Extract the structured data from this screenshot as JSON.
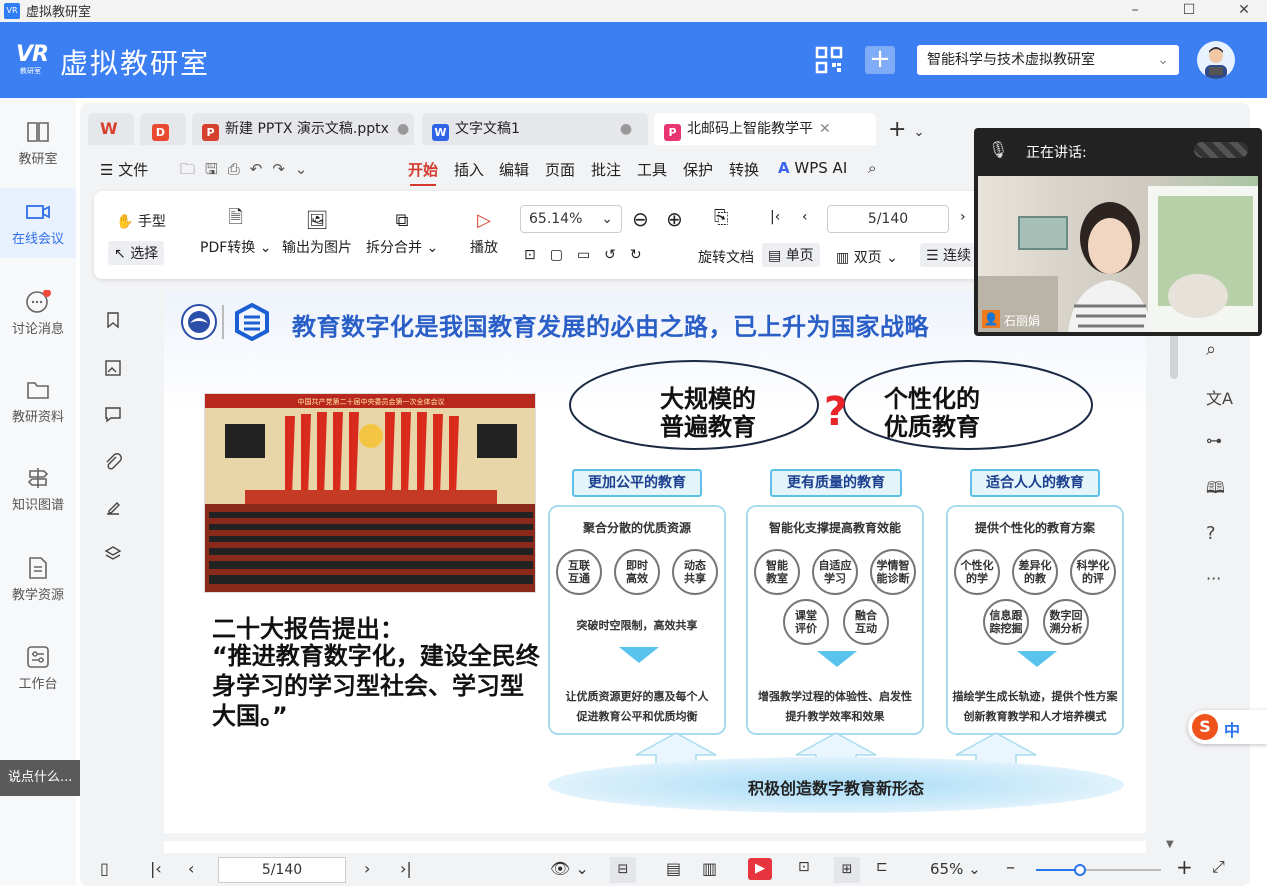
{
  "window": {
    "title": "虚拟教研室",
    "logo_text": "VR"
  },
  "header": {
    "brand_logo": "VR",
    "brand_logo_sub": "教研室",
    "brand_name": "虚拟教研室",
    "room_selector": "智能科学与技术虚拟教研室",
    "accent": "#3c7ff2"
  },
  "nav": {
    "items": [
      {
        "label": "教研室",
        "icon": "book-icon"
      },
      {
        "label": "在线会议",
        "icon": "video-camera-icon"
      },
      {
        "label": "讨论消息",
        "icon": "chat-bubble-icon"
      },
      {
        "label": "教研资料",
        "icon": "folder-icon"
      },
      {
        "label": "知识图谱",
        "icon": "signpost-icon"
      },
      {
        "label": "教学资源",
        "icon": "document-icon"
      },
      {
        "label": "工作台",
        "icon": "dashboard-icon"
      }
    ],
    "say_something": "说点什么..."
  },
  "wps": {
    "tabs": [
      {
        "label": "新建 PPTX 演示文稿.pptx",
        "icon": "P",
        "color": "#d6402f"
      },
      {
        "label": "文字文稿1",
        "icon": "W",
        "color": "#2f64e8"
      },
      {
        "label": "北邮码上智能教学平",
        "icon": "P",
        "color": "#e8346f"
      }
    ],
    "menus": [
      "文件",
      "开始",
      "插入",
      "编辑",
      "页面",
      "批注",
      "工具",
      "保护",
      "转换",
      "WPS AI"
    ],
    "toolbar": {
      "hand": "手型",
      "select": "选择",
      "pdf_convert": "PDF转换",
      "export_image": "输出为图片",
      "split_merge": "拆分合并",
      "play": "播放",
      "zoom": "65.14%",
      "rotate": "旋转文档",
      "single": "单页",
      "double": "双页",
      "continuous": "连续",
      "page": "5/140"
    },
    "bottom": {
      "page": "5/140",
      "zoom": "65%",
      "zoom_level": 0.35
    }
  },
  "slide": {
    "title": "教育数字化是我国教育发展的必由之路，已上升为国家战略",
    "photo_banner": "中国共产党第二十届中央委员会第一次全体会议",
    "quote_heading": "二十大报告提出：",
    "quote_body": "“推进教育数字化，建设全民终身学习的学习型社会、学习型大国。”",
    "left_ellipse": [
      "大规模的",
      "普遍教育"
    ],
    "right_ellipse": [
      "个性化的",
      "优质教育"
    ],
    "question": "?",
    "columns": [
      {
        "head": "更加公平的教育",
        "sub": "聚合分散的优质资源",
        "circles": [
          "互联\n互通",
          "即时\n高效",
          "动态\n共享"
        ],
        "extra": "突破时空限制，高效共享",
        "desc": [
          "让优质资源更好的惠及每个人",
          "促进教育公平和优质均衡"
        ]
      },
      {
        "head": "更有质量的教育",
        "sub": "智能化支撑提高教育效能",
        "circles": [
          "智能\n教室",
          "自适应\n学习",
          "学情智\n能诊断",
          "课堂\n评价",
          "融合\n互动"
        ],
        "desc": [
          "增强教学过程的体验性、启发性",
          "提升教学效率和效果"
        ]
      },
      {
        "head": "适合人人的教育",
        "sub": "提供个性化的教育方案",
        "circles": [
          "个性化\n的学",
          "差异化\n的教",
          "科学化\n的评",
          "信息跟\n踪挖掘",
          "数字回\n溯分析"
        ],
        "desc": [
          "描绘学生成长轨迹，提供个性方案",
          "创新教育教学和人才培养模式"
        ]
      }
    ],
    "base": "积极创造数字教育新形态"
  },
  "video": {
    "speaking": "正在讲话:",
    "speaker": "石丽娟"
  },
  "ime": {
    "label": "中"
  }
}
